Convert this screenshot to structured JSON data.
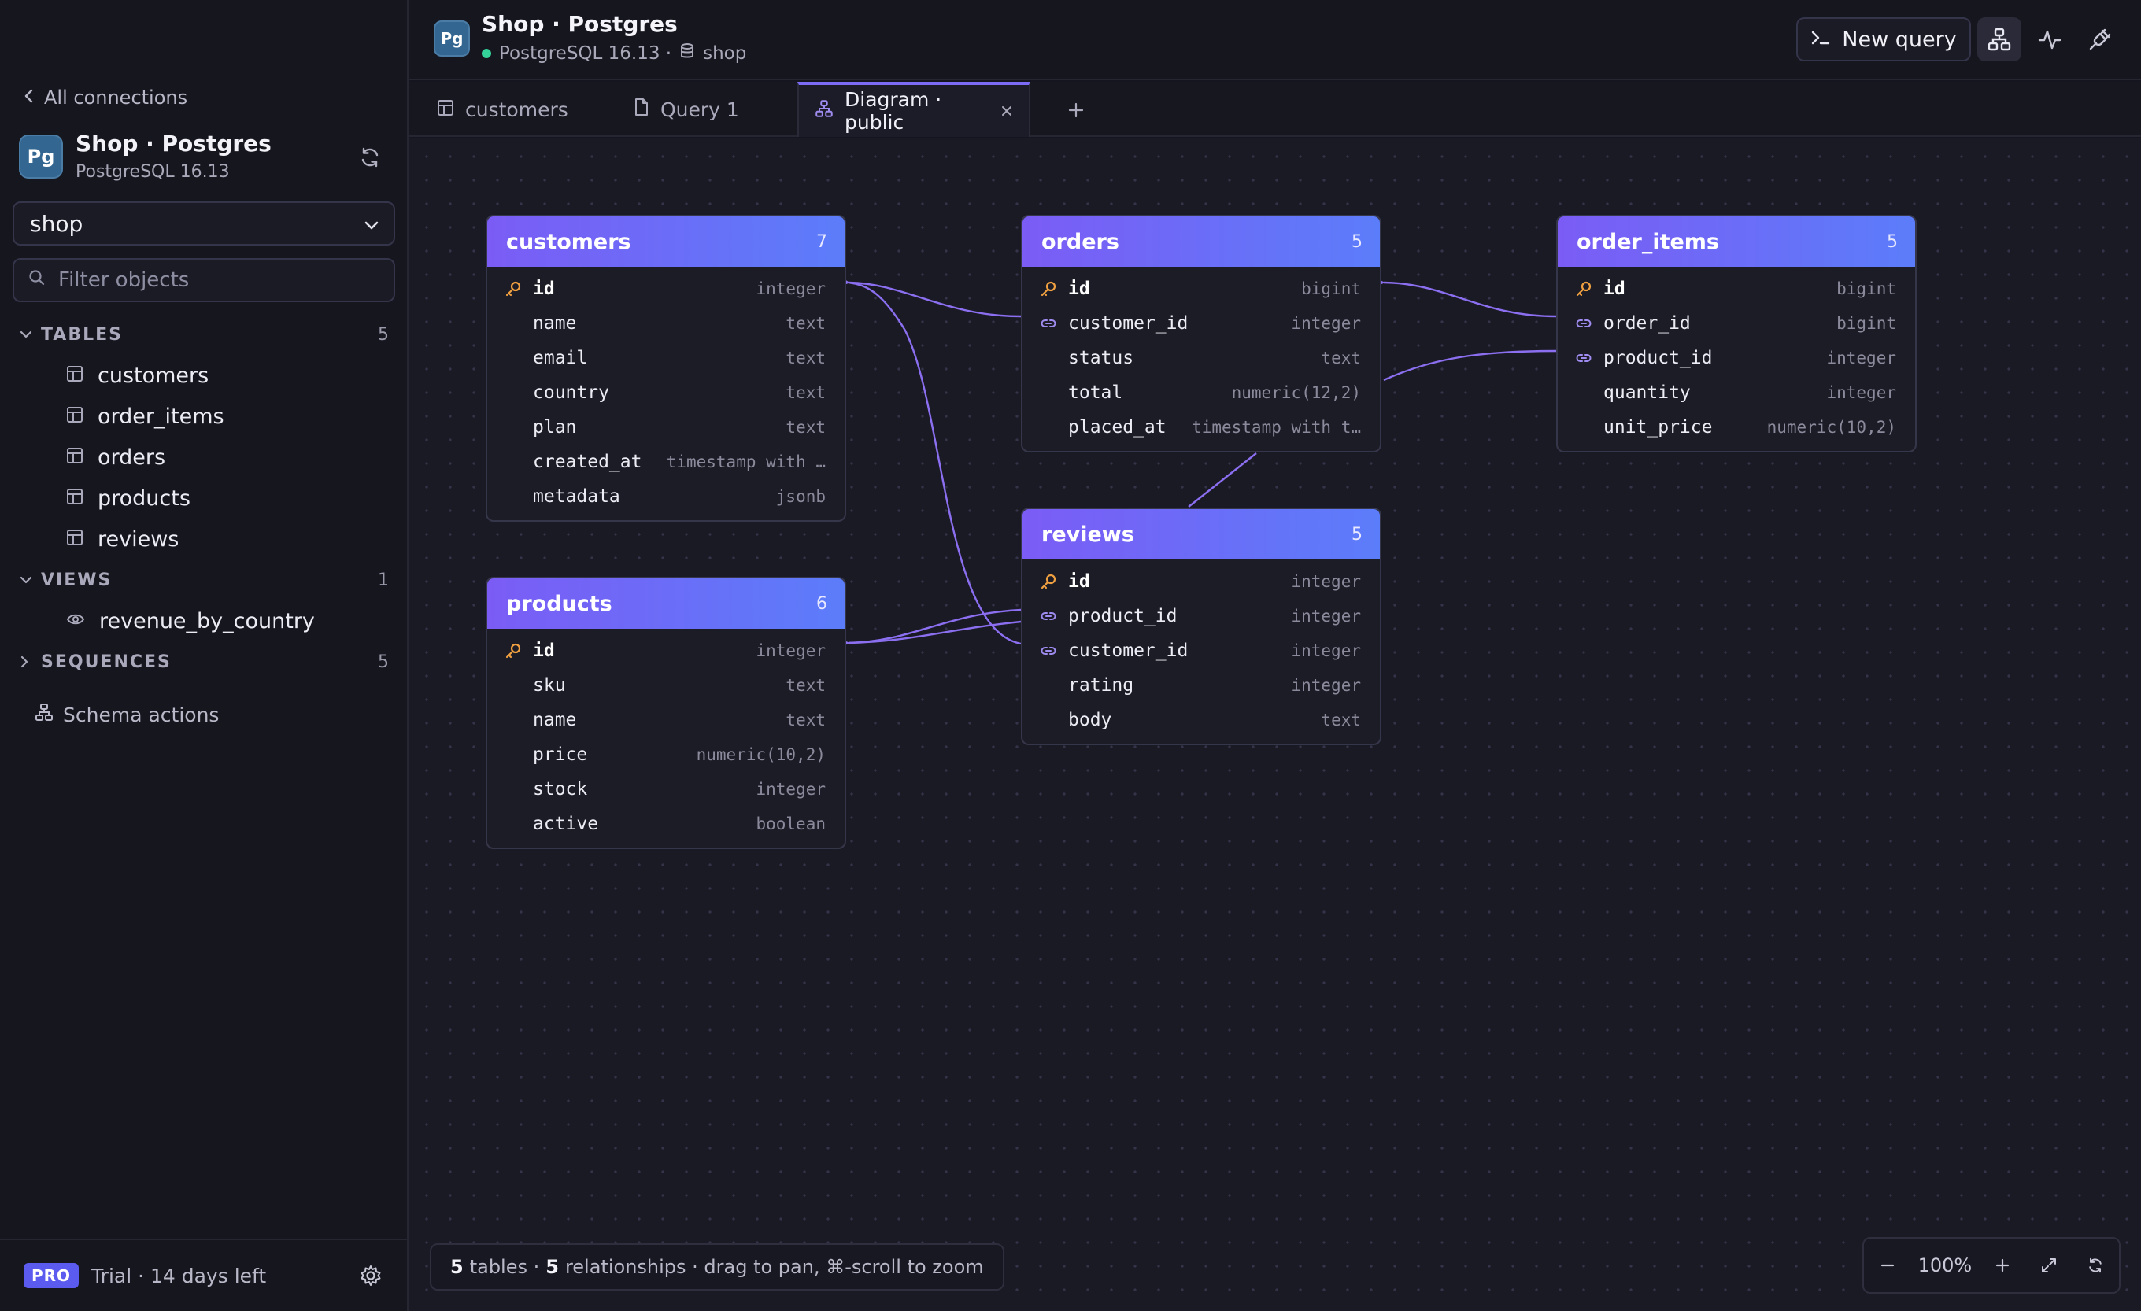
{
  "sidebar": {
    "back_label": "All connections",
    "connection": {
      "badge": "Pg",
      "name": "Shop · Postgres",
      "version": "PostgreSQL 16.13"
    },
    "database": "shop",
    "filter_placeholder": "Filter objects",
    "sections": {
      "tables": {
        "label": "TABLES",
        "count": "5",
        "items": [
          "customers",
          "order_items",
          "orders",
          "products",
          "reviews"
        ]
      },
      "views": {
        "label": "VIEWS",
        "count": "1",
        "items": [
          "revenue_by_country"
        ]
      },
      "sequences": {
        "label": "SEQUENCES",
        "count": "5"
      }
    },
    "schema_actions": "Schema actions",
    "footer": {
      "badge": "PRO",
      "trial": "Trial · 14 days left"
    }
  },
  "header": {
    "badge": "Pg",
    "title": "Shop · Postgres",
    "engine": "PostgreSQL 16.13 ·",
    "database": "shop",
    "new_query": "New query"
  },
  "tabs": [
    {
      "label": "customers",
      "icon": "table-icon"
    },
    {
      "label": "Query 1",
      "icon": "file-icon"
    },
    {
      "label": "Diagram · public",
      "icon": "diagram-icon",
      "active": true
    }
  ],
  "colors": {
    "accent": "#7c6cf5",
    "header_from": "#7b5cf5",
    "header_to": "#5b7dfa",
    "pk": "#f0a040",
    "fk": "#a08cf0"
  },
  "tables": {
    "customers": {
      "name": "customers",
      "count": "7",
      "columns": [
        {
          "name": "id",
          "type": "integer",
          "key": "pk"
        },
        {
          "name": "name",
          "type": "text"
        },
        {
          "name": "email",
          "type": "text"
        },
        {
          "name": "country",
          "type": "text"
        },
        {
          "name": "plan",
          "type": "text"
        },
        {
          "name": "created_at",
          "type": "timestamp with …"
        },
        {
          "name": "metadata",
          "type": "jsonb"
        }
      ]
    },
    "orders": {
      "name": "orders",
      "count": "5",
      "columns": [
        {
          "name": "id",
          "type": "bigint",
          "key": "pk"
        },
        {
          "name": "customer_id",
          "type": "integer",
          "key": "fk"
        },
        {
          "name": "status",
          "type": "text"
        },
        {
          "name": "total",
          "type": "numeric(12,2)"
        },
        {
          "name": "placed_at",
          "type": "timestamp with t…"
        }
      ]
    },
    "order_items": {
      "name": "order_items",
      "count": "5",
      "columns": [
        {
          "name": "id",
          "type": "bigint",
          "key": "pk"
        },
        {
          "name": "order_id",
          "type": "bigint",
          "key": "fk"
        },
        {
          "name": "product_id",
          "type": "integer",
          "key": "fk"
        },
        {
          "name": "quantity",
          "type": "integer"
        },
        {
          "name": "unit_price",
          "type": "numeric(10,2)"
        }
      ]
    },
    "products": {
      "name": "products",
      "count": "6",
      "columns": [
        {
          "name": "id",
          "type": "integer",
          "key": "pk"
        },
        {
          "name": "sku",
          "type": "text"
        },
        {
          "name": "name",
          "type": "text"
        },
        {
          "name": "price",
          "type": "numeric(10,2)"
        },
        {
          "name": "stock",
          "type": "integer"
        },
        {
          "name": "active",
          "type": "boolean"
        }
      ]
    },
    "reviews": {
      "name": "reviews",
      "count": "5",
      "columns": [
        {
          "name": "id",
          "type": "integer",
          "key": "pk"
        },
        {
          "name": "product_id",
          "type": "integer",
          "key": "fk"
        },
        {
          "name": "customer_id",
          "type": "integer",
          "key": "fk"
        },
        {
          "name": "rating",
          "type": "integer"
        },
        {
          "name": "body",
          "type": "text"
        }
      ]
    }
  },
  "status": {
    "tables_count": "5",
    "tables_word": "tables ·",
    "rels_count": "5",
    "rels_word": "relationships · drag to pan, ⌘-scroll to zoom"
  },
  "zoom": {
    "level": "100%"
  }
}
